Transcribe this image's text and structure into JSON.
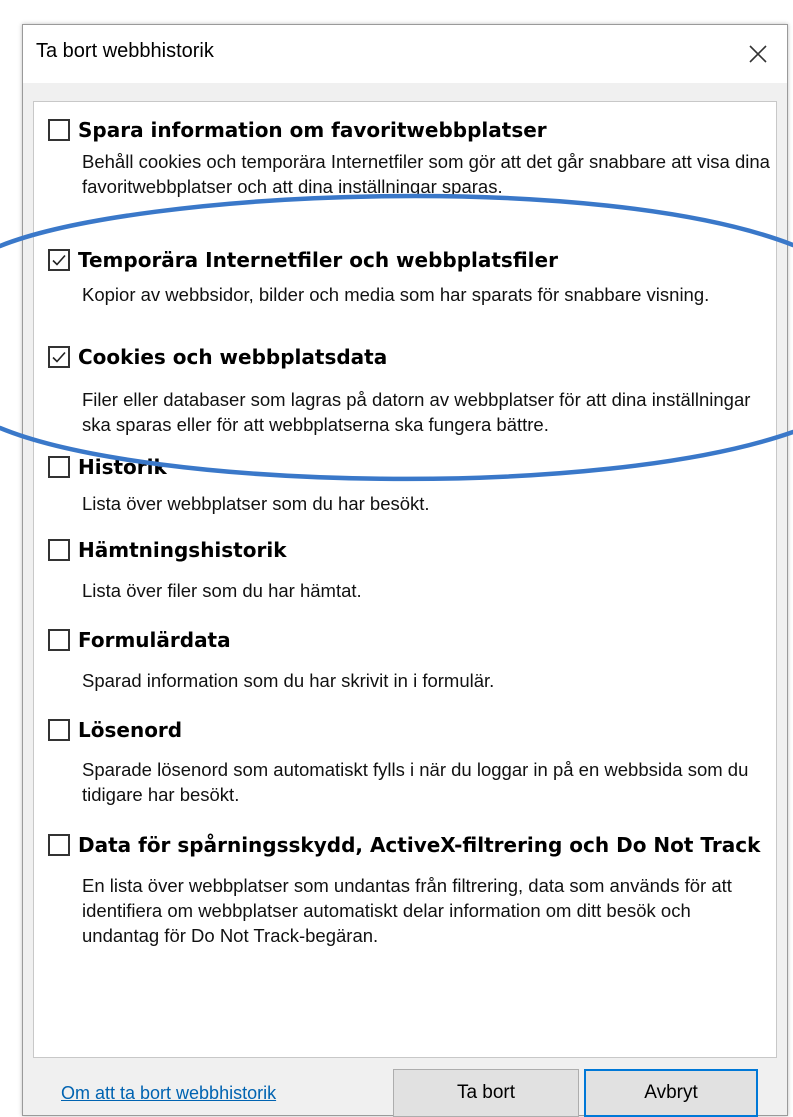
{
  "dialog": {
    "title": "Ta bort webbhistorik",
    "close_icon": "close-icon"
  },
  "options": [
    {
      "label": "Spara information om favoritwebbplatser",
      "description": "Behåll cookies och temporära Internetfiler som gör att det går snabbare att visa dina favoritwebbplatser och att dina inställningar sparas.",
      "checked": false
    },
    {
      "label": "Temporära Internetfiler och webbplatsfiler",
      "description": "Kopior av webbsidor, bilder och media som har sparats för snabbare visning.",
      "checked": true
    },
    {
      "label": "Cookies och webbplatsdata",
      "description": "Filer eller databaser som lagras på datorn av webbplatser för att dina inställningar ska sparas eller för att webbplatserna ska fungera bättre.",
      "checked": true
    },
    {
      "label": "Historik",
      "description": "Lista över webbplatser som du har besökt.",
      "checked": false
    },
    {
      "label": "Hämtningshistorik",
      "description": "Lista över filer som du har hämtat.",
      "checked": false
    },
    {
      "label": "Formulärdata",
      "description": "Sparad information som du har skrivit in i formulär.",
      "checked": false
    },
    {
      "label": "Lösenord",
      "description": "Sparade lösenord som automatiskt fylls i när du loggar in på en webbsida som du tidigare har besökt.",
      "checked": false
    },
    {
      "label": "Data för spårningsskydd, ActiveX-filtrering och Do Not Track",
      "description": "En lista över webbplatser som undantas från filtrering, data som används för att identifiera om webbplatser automatiskt delar information om ditt besök och undantag för Do Not Track-begäran.",
      "checked": false
    }
  ],
  "footer": {
    "link": "Om att ta bort webbhistorik",
    "delete_button": "Ta bort",
    "cancel_button": "Avbryt"
  },
  "colors": {
    "annotation_ellipse": "#3a78c9",
    "link": "#0063b1",
    "default_button_border": "#0078d7"
  }
}
